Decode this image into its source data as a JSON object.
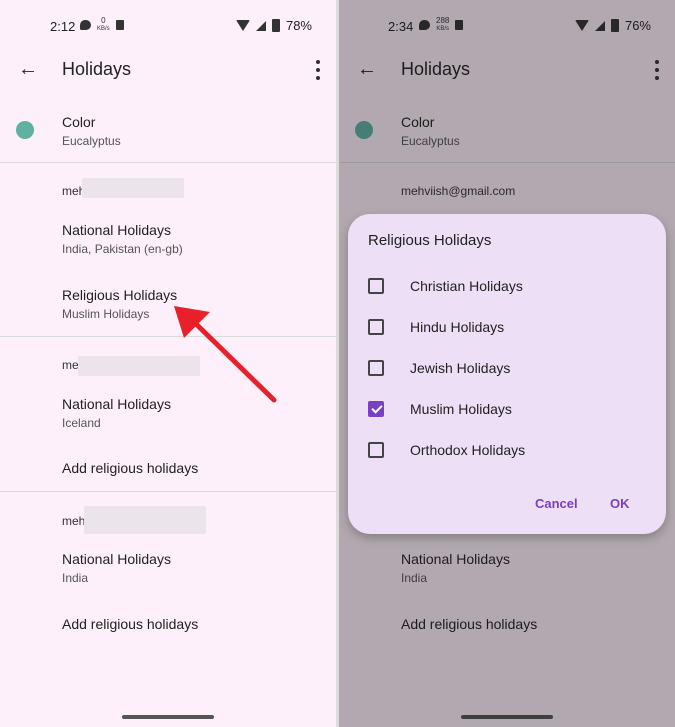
{
  "left": {
    "status": {
      "time": "2:12",
      "kb_value": "0",
      "kb_unit": "KB/s",
      "battery": "78%"
    },
    "title": "Holidays",
    "color_row": {
      "label": "Color",
      "value": "Eucalyptus",
      "swatch": "#5fb1a4"
    },
    "account1": {
      "prefix": "meh"
    },
    "national1": {
      "label": "National Holidays",
      "value": "India, Pakistan (en-gb)"
    },
    "religious1": {
      "label": "Religious Holidays",
      "value": "Muslim Holidays"
    },
    "account2": {
      "prefix": "me"
    },
    "national2": {
      "label": "National Holidays",
      "value": "Iceland"
    },
    "add2": "Add religious holidays",
    "account3": {
      "prefix": "meh"
    },
    "national3": {
      "label": "National Holidays",
      "value": "India"
    },
    "add3": "Add religious holidays"
  },
  "right": {
    "status": {
      "time": "2:34",
      "kb_value": "288",
      "kb_unit": "KB/s",
      "battery": "76%"
    },
    "title": "Holidays",
    "color_row": {
      "label": "Color",
      "value": "Eucalyptus"
    },
    "account1": "mehviish@gmail.com",
    "national3": {
      "label": "National Holidays",
      "value": "India"
    },
    "add3": "Add religious holidays",
    "dialog": {
      "title": "Religious Holidays",
      "options": [
        {
          "label": "Christian Holidays",
          "checked": false
        },
        {
          "label": "Hindu Holidays",
          "checked": false
        },
        {
          "label": "Jewish Holidays",
          "checked": false
        },
        {
          "label": "Muslim Holidays",
          "checked": true
        },
        {
          "label": "Orthodox Holidays",
          "checked": false
        }
      ],
      "cancel": "Cancel",
      "ok": "OK"
    }
  },
  "colors": {
    "accent": "#7b3fc4",
    "arrow": "#e8202a",
    "background": "#fdf0fa"
  }
}
